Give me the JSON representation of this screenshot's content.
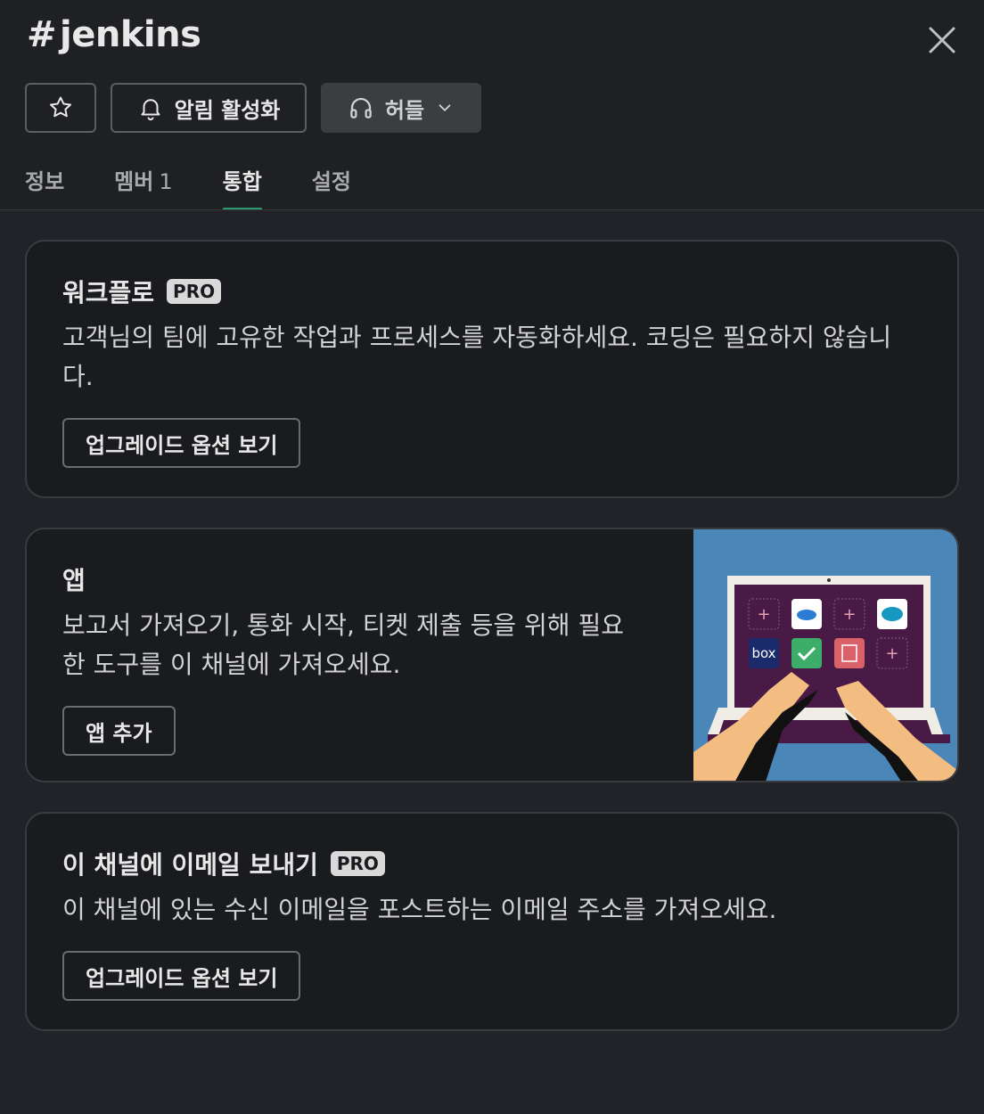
{
  "header": {
    "hash": "#",
    "channel_name": "jenkins",
    "notify_label": "알림 활성화",
    "huddle_label": "허들"
  },
  "tabs": [
    {
      "label": "정보",
      "count": ""
    },
    {
      "label": "멤버",
      "count": "1"
    },
    {
      "label": "통합",
      "count": ""
    },
    {
      "label": "설정",
      "count": ""
    }
  ],
  "active_tab": "통합",
  "cards": {
    "workflow": {
      "title": "워크플로",
      "badge": "PRO",
      "description": "고객님의 팀에 고유한 작업과 프로세스를 자동화하세요. 코딩은 필요하지 않습니다.",
      "button": "업그레이드 옵션 보기"
    },
    "apps": {
      "title": "앱",
      "description": "보고서 가져오기, 통화 시작, 티켓 제출 등을 위해 필요한 도구를 이 채널에 가져오세요.",
      "button": "앱 추가",
      "illustration_box_text": "box"
    },
    "email": {
      "title": "이 채널에 이메일 보내기",
      "badge": "PRO",
      "description": "이 채널에 있는 수신 이메일을 포스트하는 이메일 주소를 가져오세요.",
      "button": "업그레이드 옵션 보기"
    }
  },
  "colors": {
    "accent_tab": "#2a9d6e",
    "illustration_bg": "#4a86b8",
    "laptop_screen": "#4a1a47"
  }
}
